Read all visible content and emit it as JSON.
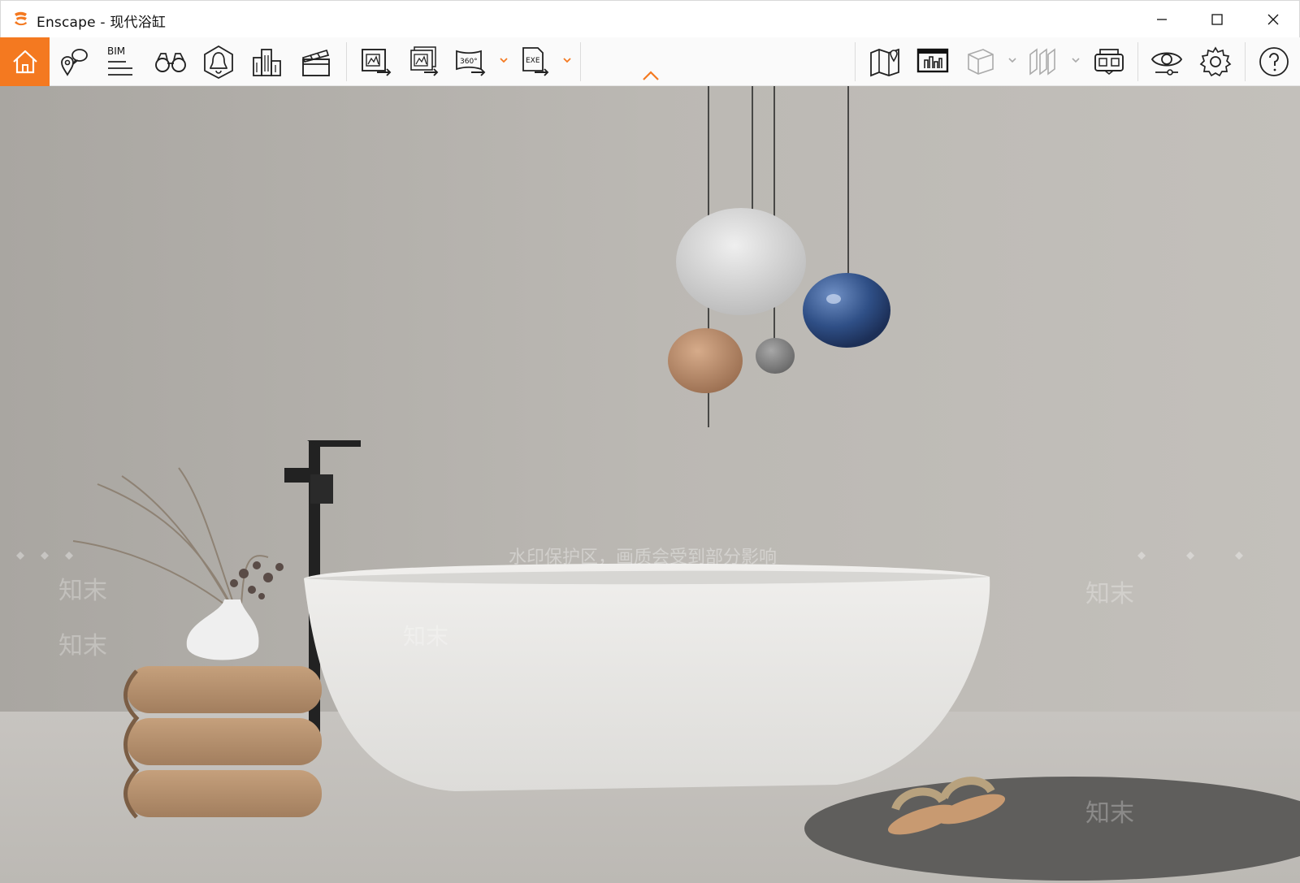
{
  "window": {
    "title": "Enscape - 现代浴缸",
    "controls": {
      "minimize_icon": "minimize-icon",
      "maximize_icon": "maximize-icon",
      "close_icon": "close-icon"
    }
  },
  "toolbar": {
    "accent_color": "#f47920",
    "left_group": [
      {
        "name": "home-button",
        "icon": "home-icon"
      },
      {
        "name": "location-comments-button",
        "icon": "map-pin-chat-icon"
      },
      {
        "name": "bim-button",
        "icon": "bim-icon",
        "label": "BIM"
      },
      {
        "name": "views-button",
        "icon": "binoculars-icon"
      },
      {
        "name": "atmosphere-button",
        "icon": "light-icon"
      },
      {
        "name": "assets-button",
        "icon": "buildings-icon"
      },
      {
        "name": "video-editor-button",
        "icon": "clapperboard-icon"
      }
    ],
    "export_group": [
      {
        "name": "screenshot-button",
        "icon": "image-export-icon"
      },
      {
        "name": "batch-render-button",
        "icon": "batch-image-export-icon"
      },
      {
        "name": "panorama-button",
        "icon": "panorama-360-icon",
        "label": "360°"
      },
      {
        "name": "exe-export-button",
        "icon": "exe-export-icon",
        "label": "EXE"
      }
    ],
    "right_group": [
      {
        "name": "map-button",
        "icon": "map-icon"
      },
      {
        "name": "web-standalone-button",
        "icon": "monitor-icon"
      },
      {
        "name": "section-box-button",
        "icon": "cube-icon"
      },
      {
        "name": "orthographic-button",
        "icon": "orthographic-icon"
      },
      {
        "name": "vr-headset-button",
        "icon": "vr-headset-icon"
      },
      {
        "name": "visual-settings-button",
        "icon": "eye-icon"
      },
      {
        "name": "settings-button",
        "icon": "gear-icon"
      },
      {
        "name": "help-button",
        "icon": "help-icon"
      }
    ],
    "collapse_icon": "chevron-up-icon"
  },
  "viewport": {
    "scene": "bathroom render with freestanding bathtub",
    "watermark": {
      "banner": "水印保护区，画质会受到部分影响",
      "tile": "知末"
    },
    "colors": {
      "wall": "#b9b6b1",
      "floor": "#c4c1bd",
      "tub": "#e9e8e6",
      "blue_glass": "#2f4f86",
      "amber_glass": "#b58666"
    }
  }
}
